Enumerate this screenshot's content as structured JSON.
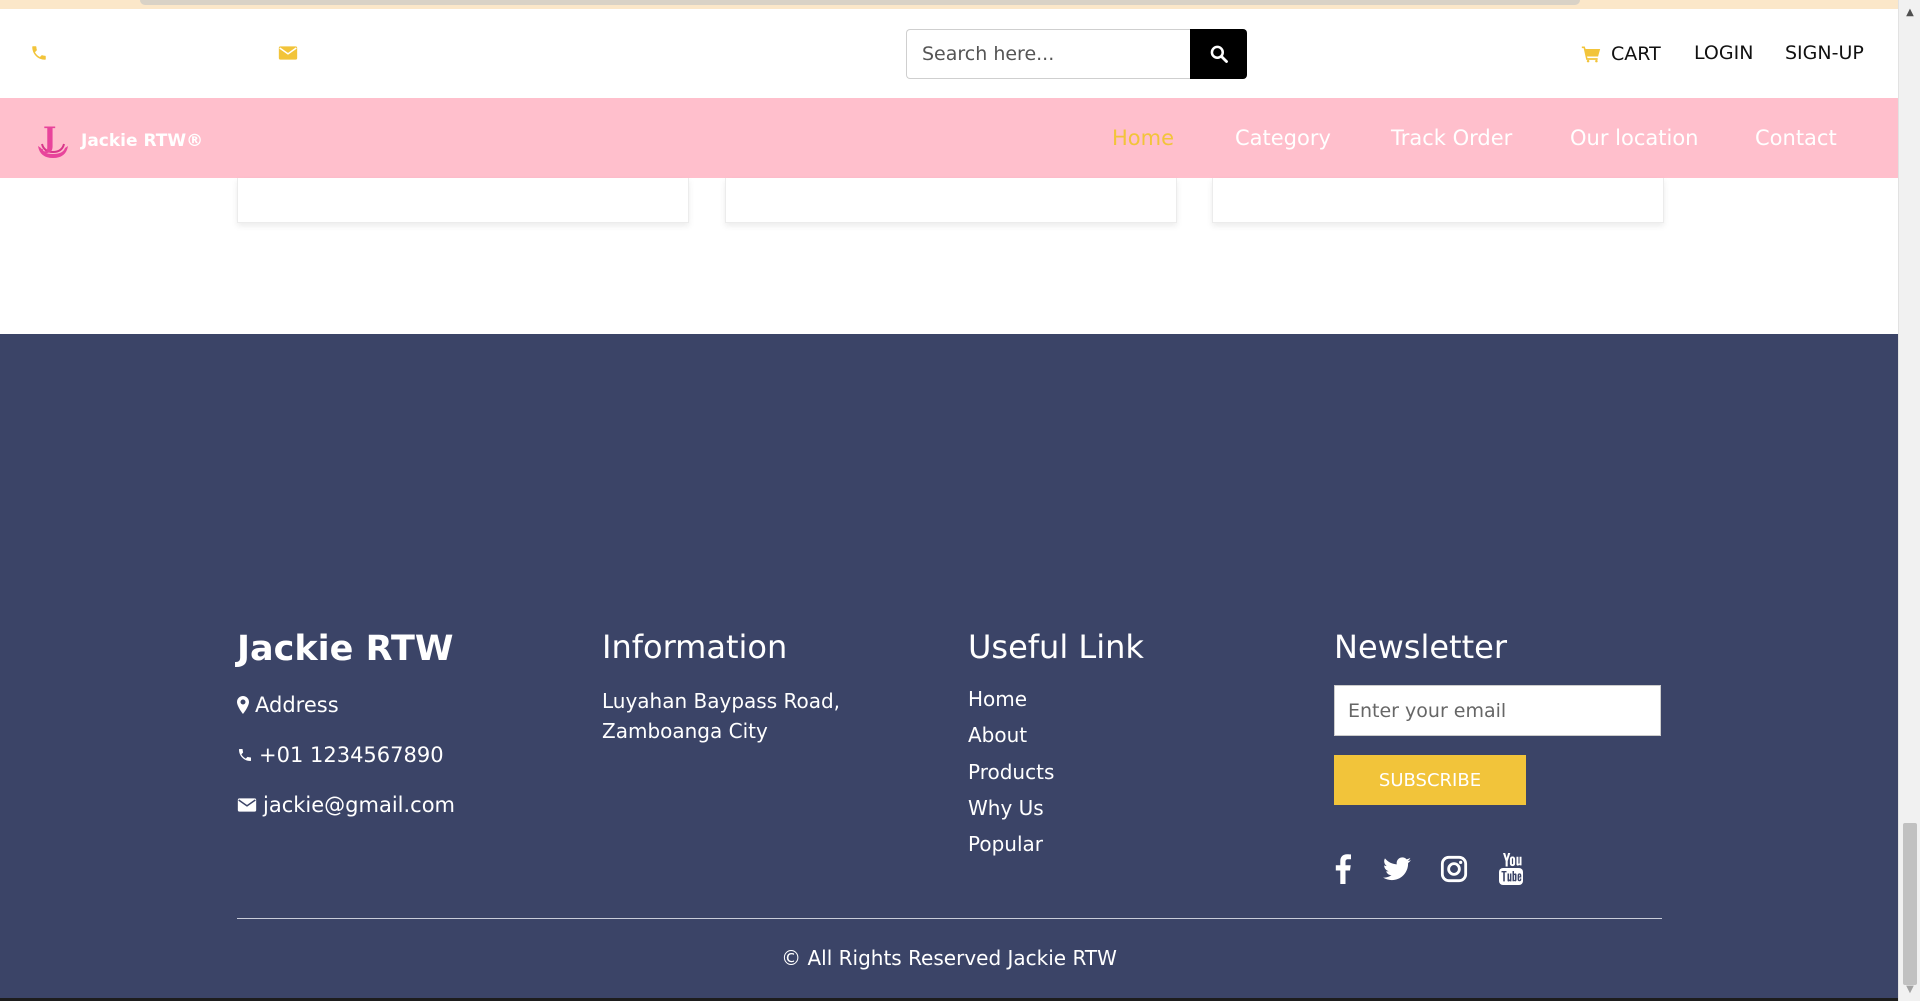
{
  "header": {
    "search_placeholder": "Search here...",
    "cart_label": "CART",
    "login_label": "LOGIN",
    "signup_label": "SIGN-UP"
  },
  "brand": {
    "logo_text": "Jackie RTW®",
    "logo_letter": "J"
  },
  "nav": {
    "items": [
      {
        "label": "Home",
        "active": true
      },
      {
        "label": "Category",
        "active": false
      },
      {
        "label": "Track Order",
        "active": false
      },
      {
        "label": "Our location",
        "active": false
      },
      {
        "label": "Contact",
        "active": false
      }
    ]
  },
  "footer": {
    "brand_title": "Jackie RTW",
    "address_label": "Address",
    "phone": "+01 1234567890",
    "email": "jackie@gmail.com",
    "information": {
      "heading": "Information",
      "line1": "Luyahan Baypass Road,",
      "line2": "Zamboanga City"
    },
    "useful_links": {
      "heading": "Useful Link",
      "items": [
        "Home",
        "About",
        "Products",
        "Why Us",
        "Popular"
      ]
    },
    "newsletter": {
      "heading": "Newsletter",
      "email_placeholder": "Enter your email",
      "subscribe_label": "SUBSCRIBE"
    },
    "social_icons": [
      "facebook-icon",
      "twitter-icon",
      "instagram-icon",
      "youtube-icon"
    ],
    "copyright": "© All Rights Reserved Jackie RTW"
  },
  "colors": {
    "accent": "#f2c43a",
    "nav_bg": "#ffbfcc",
    "footer_bg": "#3b4467",
    "logo_pink": "#e8449b"
  }
}
